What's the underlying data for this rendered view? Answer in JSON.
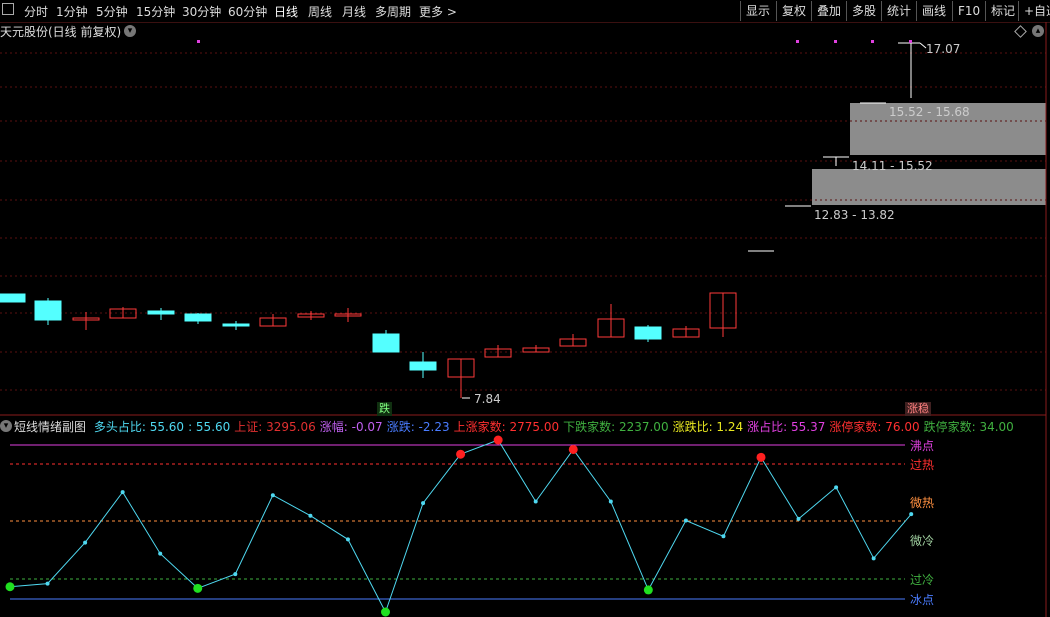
{
  "toolbar": {
    "periods": [
      "分时",
      "1分钟",
      "5分钟",
      "15分钟",
      "30分钟",
      "60分钟",
      "日线",
      "周线",
      "月线",
      "多周期",
      "更多 >"
    ],
    "active_period": "日线",
    "right_buttons": [
      "显示",
      "复权",
      "叠加",
      "多股",
      "统计",
      "画线",
      "F10",
      "标记",
      "+自选"
    ]
  },
  "chart_title": "天元股份(日线 前复权)",
  "price_labels": {
    "high": "17.07",
    "low": "7.84",
    "range1": "15.52 - 15.68",
    "range2": "14.11 - 15.52",
    "range3": "12.83 - 13.82"
  },
  "markers": {
    "die": "跌",
    "zhangting": "涨稳"
  },
  "sub_indicator": {
    "name": "短线情绪副图",
    "items": [
      {
        "label": "多头占比: 55.60",
        "color": "#4fd8f0"
      },
      {
        "label": ": 55.60",
        "color": "#4fd8f0"
      },
      {
        "label": "上证: 3295.06",
        "color": "#e03030"
      },
      {
        "label": "涨幅: -0.07",
        "color": "#c060f0"
      },
      {
        "label": "涨跌: -2.23",
        "color": "#4a7cff"
      },
      {
        "label": "上涨家数: 2775.00",
        "color": "#ff3030"
      },
      {
        "label": "下跌家数: 2237.00",
        "color": "#40b040"
      },
      {
        "label": "涨跌比: 1.24",
        "color": "#e8e820"
      },
      {
        "label": "涨占比: 55.37",
        "color": "#e040e0"
      },
      {
        "label": "涨停家数: 76.00",
        "color": "#ff3030"
      },
      {
        "label": "跌停家数: 34.00",
        "color": "#40b040"
      }
    ],
    "levels": [
      {
        "name": "沸点",
        "color": "#e040e0"
      },
      {
        "name": "过热",
        "color": "#ff3030"
      },
      {
        "name": "微热",
        "color": "#ff9040"
      },
      {
        "name": "微冷",
        "color": "#a0d0a0"
      },
      {
        "name": "过冷",
        "color": "#40b040"
      },
      {
        "name": "冰点",
        "color": "#4a7cff"
      }
    ]
  },
  "chart_data": {
    "type": "line",
    "series": [
      {
        "values": [
          10,
          12,
          38,
          70,
          31,
          9,
          18,
          68,
          55,
          40,
          -6,
          63,
          94,
          103,
          64,
          97,
          64,
          8,
          52,
          42,
          92,
          53,
          73,
          28,
          56
        ]
      }
    ],
    "highlight_red_index": [
      12,
      13,
      15,
      20
    ],
    "highlight_green_index": [
      0,
      5,
      10,
      17
    ]
  },
  "colors": {
    "up": "#ff3a3a",
    "down": "#54ffff",
    "accent": "#ff3030"
  }
}
